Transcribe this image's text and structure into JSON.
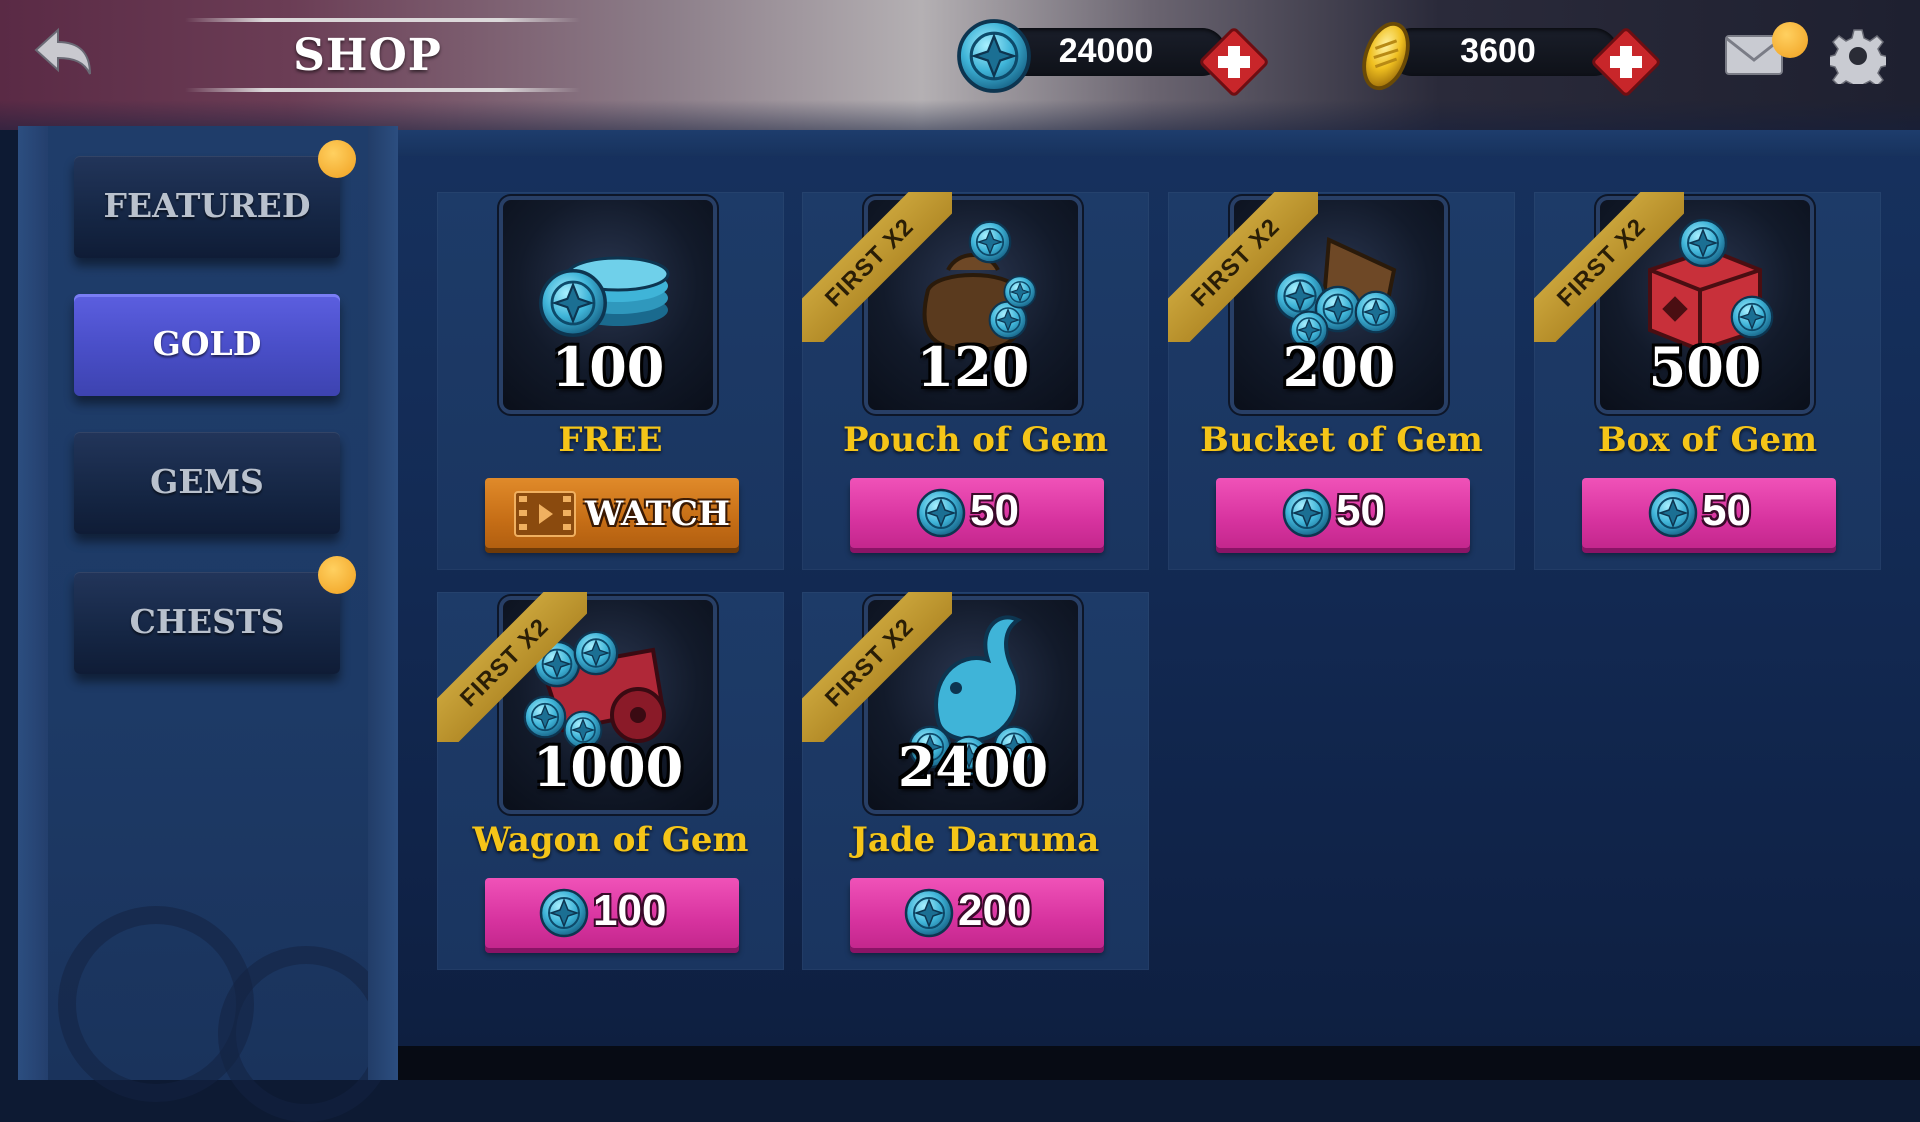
{
  "header": {
    "title": "SHOP",
    "gems_count": "24000",
    "gold_count": "3600"
  },
  "sidebar": {
    "tabs": [
      {
        "label": "FEATURED",
        "active": false,
        "badge": true
      },
      {
        "label": "GOLD",
        "active": true,
        "badge": false
      },
      {
        "label": "GEMS",
        "active": false,
        "badge": false
      },
      {
        "label": "CHESTS",
        "active": false,
        "badge": true
      }
    ]
  },
  "offers": [
    {
      "amount": "100",
      "name": "FREE",
      "button": "WATCH",
      "ribbon": "",
      "icon": "gem-stack-icon"
    },
    {
      "amount": "120",
      "name": "Pouch of Gem",
      "price": "50",
      "ribbon": "FIRST X2",
      "icon": "gem-pouch-icon"
    },
    {
      "amount": "200",
      "name": "Bucket of Gem",
      "price": "50",
      "ribbon": "FIRST X2",
      "icon": "gem-bucket-icon"
    },
    {
      "amount": "500",
      "name": "Box of Gem",
      "price": "50",
      "ribbon": "FIRST X2",
      "icon": "gem-box-icon"
    },
    {
      "amount": "1000",
      "name": "Wagon of Gem",
      "price": "100",
      "ribbon": "FIRST X2",
      "icon": "gem-wagon-icon"
    },
    {
      "amount": "2400",
      "name": "Jade Daruma",
      "price": "200",
      "ribbon": "FIRST X2",
      "icon": "jade-fish-icon"
    }
  ],
  "colors": {
    "accent_tab": "#4a4fc9",
    "buy_button": "#d7339f",
    "watch_button": "#c66e16",
    "item_name": "#f5c518",
    "badge": "#f0a020"
  }
}
